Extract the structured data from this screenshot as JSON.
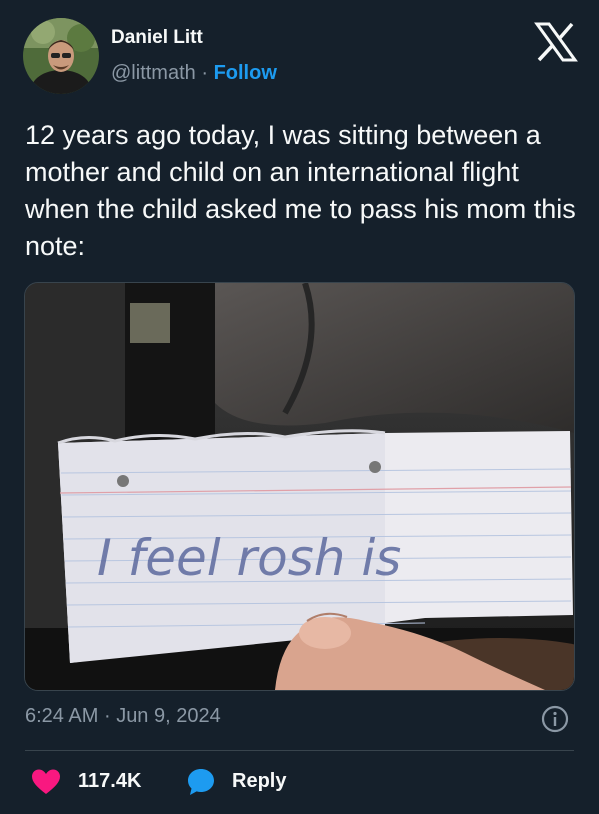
{
  "author": {
    "name": "Daniel Litt",
    "handle": "@littmath",
    "separator": "·",
    "follow_label": "Follow"
  },
  "tweet": {
    "text": "12 years ago today, I was sitting between a mother and child on an international flight when the child asked me to pass his mom this note:"
  },
  "photo": {
    "note_text": "I feel rosh is"
  },
  "meta": {
    "time": "6:24 AM",
    "separator": "·",
    "date": "Jun 9, 2024"
  },
  "actions": {
    "like_count": "117.4K",
    "reply_label": "Reply"
  },
  "colors": {
    "background": "#15202b",
    "accent": "#1d9bf0",
    "like": "#f91880",
    "muted": "#8b98a5"
  },
  "icons": [
    "x-logo-icon",
    "info-icon",
    "heart-icon",
    "reply-bubble-icon"
  ]
}
